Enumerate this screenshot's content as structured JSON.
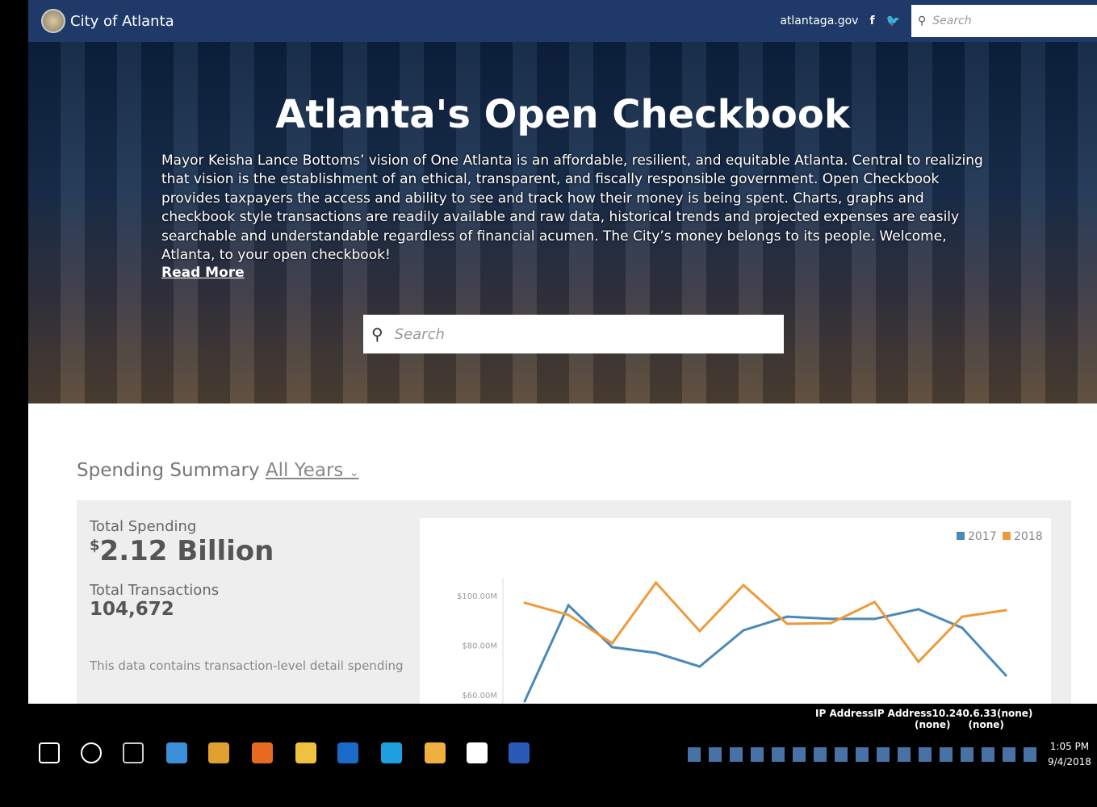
{
  "header": {
    "brand": "City of Atlanta",
    "site_link": "atlantaga.gov",
    "search_placeholder": "Search"
  },
  "hero": {
    "title": "Atlanta's Open Checkbook",
    "intro": "Mayor Keisha Lance Bottoms’ vision of One Atlanta is an affordable, resilient, and equitable Atlanta. Central to realizing that vision is the establishment of an ethical, transparent, and fiscally responsible government. Open Checkbook provides taxpayers the access and ability to see and track how their money is being spent. Charts, graphs and checkbook style transactions are readily available and raw data, historical trends and projected expenses are easily searchable and understandable regardless of financial acumen. The City’s money belongs to its people. Welcome, Atlanta, to your open checkbook!",
    "read_more": "Read More",
    "search_placeholder": "Search"
  },
  "summary": {
    "title": "Spending Summary",
    "year_select": "All Years",
    "total_spending_label": "Total Spending",
    "total_spending_currency": "$",
    "total_spending_value": "2.12 Billion",
    "total_transactions_label": "Total Transactions",
    "total_transactions_value": "104,672",
    "note": "This data contains transaction-level detail spending"
  },
  "chart_data": {
    "type": "line",
    "yticks": [
      "$100.00M",
      "$80.00M",
      "$60.00M"
    ],
    "ylim": [
      57,
      110
    ],
    "legend_position": "top-right",
    "series": [
      {
        "name": "2017",
        "color": "#4a8ab8",
        "values": [
          57.4,
          96.1,
          79.2,
          76.9,
          71.4,
          86,
          91.5,
          90.6,
          90.6,
          94.5,
          87,
          67.8
        ]
      },
      {
        "name": "2018",
        "color": "#ef9a3a",
        "values": [
          97.1,
          92.2,
          80.8,
          105.2,
          85.7,
          104.2,
          88.6,
          88.9,
          97.4,
          73.3,
          91.5,
          94.1
        ]
      }
    ]
  },
  "taskbar": {
    "ip_line": "IP AddressIP Address10.240.6.33(none)",
    "none1": "(none)",
    "none2": "(none)",
    "time": "1:05 PM",
    "date": "9/4/2018",
    "apps": [
      "windows-start",
      "cortana",
      "task-view",
      "internet-explorer",
      "chrome",
      "firefox",
      "file-explorer",
      "outlook",
      "skype",
      "people",
      "slack",
      "word"
    ]
  }
}
